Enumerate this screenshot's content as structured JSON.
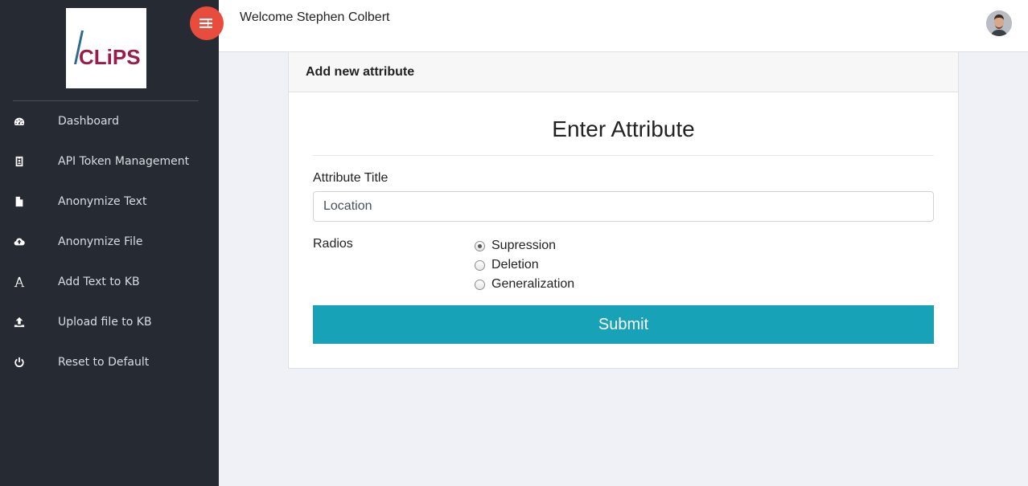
{
  "sidebar": {
    "logo_text": "CLiPS",
    "items": [
      {
        "label": "Dashboard",
        "icon": "dashboard-icon"
      },
      {
        "label": "API Token Management",
        "icon": "id-badge-icon"
      },
      {
        "label": "Anonymize Text",
        "icon": "file-text-icon"
      },
      {
        "label": "Anonymize File",
        "icon": "cloud-upload-icon"
      },
      {
        "label": "Add Text to KB",
        "icon": "font-icon"
      },
      {
        "label": "Upload file to KB",
        "icon": "upload-icon"
      },
      {
        "label": "Reset to Default",
        "icon": "power-icon"
      }
    ]
  },
  "header": {
    "welcome": "Welcome Stephen Colbert"
  },
  "card": {
    "header_title": "Add new attribute",
    "form_title": "Enter Attribute",
    "attribute_label": "Attribute Title",
    "attribute_value": "Location",
    "radios_label": "Radios",
    "radio_options": [
      "Supression",
      "Deletion",
      "Generalization"
    ],
    "selected_option": "Supression",
    "submit_label": "Submit"
  },
  "colors": {
    "sidebar_bg": "#262b33",
    "toggle": "#e84c3d",
    "submit": "#17a2b8",
    "logo_accent": "#9b1b4a"
  }
}
